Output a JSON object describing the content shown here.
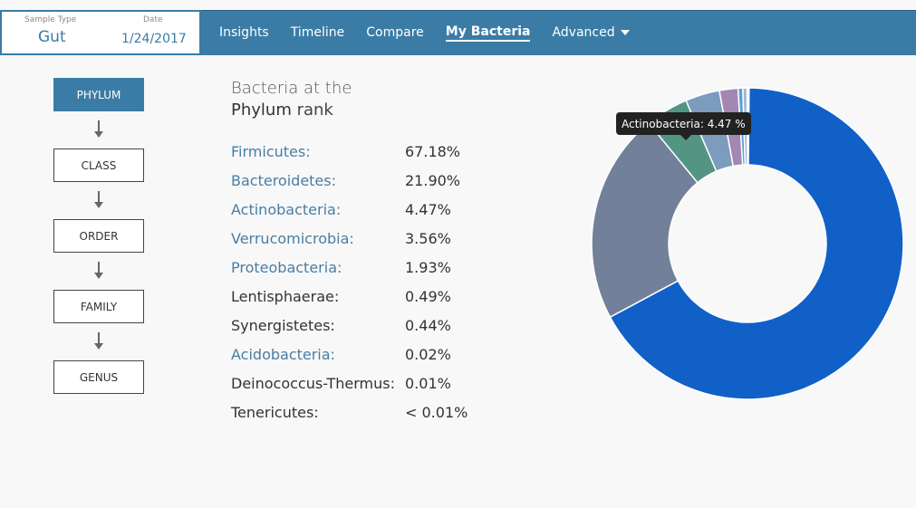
{
  "sample": {
    "type_label": "Sample Type",
    "type_value": "Gut",
    "date_label": "Date",
    "date_value": "1/24/2017"
  },
  "nav": {
    "items": [
      {
        "label": "Insights"
      },
      {
        "label": "Timeline"
      },
      {
        "label": "Compare"
      },
      {
        "label": "My Bacteria"
      },
      {
        "label": "Advanced"
      }
    ]
  },
  "ranks": {
    "items": [
      {
        "label": "PHYLUM",
        "active": true
      },
      {
        "label": "CLASS",
        "active": false
      },
      {
        "label": "ORDER",
        "active": false
      },
      {
        "label": "FAMILY",
        "active": false
      },
      {
        "label": "GENUS",
        "active": false
      }
    ]
  },
  "heading": {
    "line1": "Bacteria at the",
    "rank": "Phylum",
    "suffix": " rank"
  },
  "bacteria": [
    {
      "name": "Firmicutes:",
      "pct": "67.18%",
      "link": true
    },
    {
      "name": "Bacteroidetes:",
      "pct": "21.90%",
      "link": true
    },
    {
      "name": "Actinobacteria:",
      "pct": "4.47%",
      "link": true
    },
    {
      "name": "Verrucomicrobia:",
      "pct": "3.56%",
      "link": true
    },
    {
      "name": "Proteobacteria:",
      "pct": "1.93%",
      "link": true
    },
    {
      "name": "Lentisphaerae:",
      "pct": "0.49%",
      "link": false
    },
    {
      "name": "Synergistetes:",
      "pct": "0.44%",
      "link": false
    },
    {
      "name": "Acidobacteria:",
      "pct": "0.02%",
      "link": true
    },
    {
      "name": "Deinococcus-Thermus:",
      "pct": "0.01%",
      "link": false
    },
    {
      "name": "Tenericutes:",
      "pct": "< 0.01%",
      "link": false
    }
  ],
  "chart_data": {
    "type": "pie",
    "variant": "donut",
    "categories": [
      "Firmicutes",
      "Bacteroidetes",
      "Actinobacteria",
      "Verrucomicrobia",
      "Proteobacteria",
      "Lentisphaerae",
      "Synergistetes",
      "Acidobacteria",
      "Deinococcus-Thermus",
      "Tenericutes"
    ],
    "values": [
      67.18,
      21.9,
      4.47,
      3.56,
      1.93,
      0.49,
      0.44,
      0.02,
      0.01,
      0.005
    ],
    "colors": [
      "#1060c8",
      "#72809a",
      "#549483",
      "#7b9cbc",
      "#a287b4",
      "#5f9ed0",
      "#9ab8d4",
      "#7ab0e0",
      "#4a7da3",
      "#cfd8e0"
    ],
    "tooltip": "Actinobacteria: 4.47 %"
  }
}
